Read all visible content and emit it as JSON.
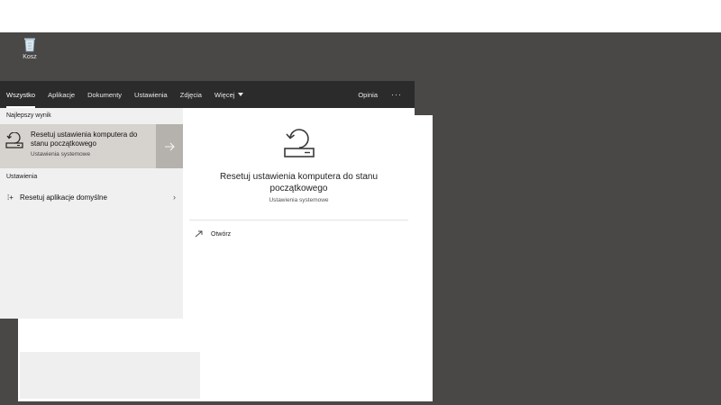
{
  "desktop": {
    "recycle_bin_label": "Kosz",
    "recycle_bin_icon": "recycle-bin-icon"
  },
  "search": {
    "tabs": [
      "Wszystko",
      "Aplikacje",
      "Dokumenty",
      "Ustawienia",
      "Zdjęcia",
      "Więcej"
    ],
    "active_tab": "Wszystko",
    "feedback_label": "Opinia",
    "more_options": "···"
  },
  "results": {
    "best_match_header": "Najlepszy wynik",
    "best_match": {
      "title": "Resetuj ustawienia komputera do stanu początkowego",
      "subtitle": "Ustawienia systemowe",
      "icon": "reset-pc-icon"
    },
    "settings_header": "Ustawienia",
    "settings_items": [
      {
        "label": "Resetuj aplikacje domyślne",
        "icon": "reset-apps-icon"
      }
    ]
  },
  "preview": {
    "title": "Resetuj ustawienia komputera do stanu początkowego",
    "subtitle": "Ustawienia systemowe",
    "open_label": "Otwórz",
    "icon": "reset-pc-icon"
  },
  "colors": {
    "desktop_bg": "#4a4847",
    "search_bar_bg": "#2b2b2b",
    "selected_bg": "#d6d3cf",
    "arrow_bg": "#b5b1ac",
    "panel_bg": "#f0f0f0"
  }
}
